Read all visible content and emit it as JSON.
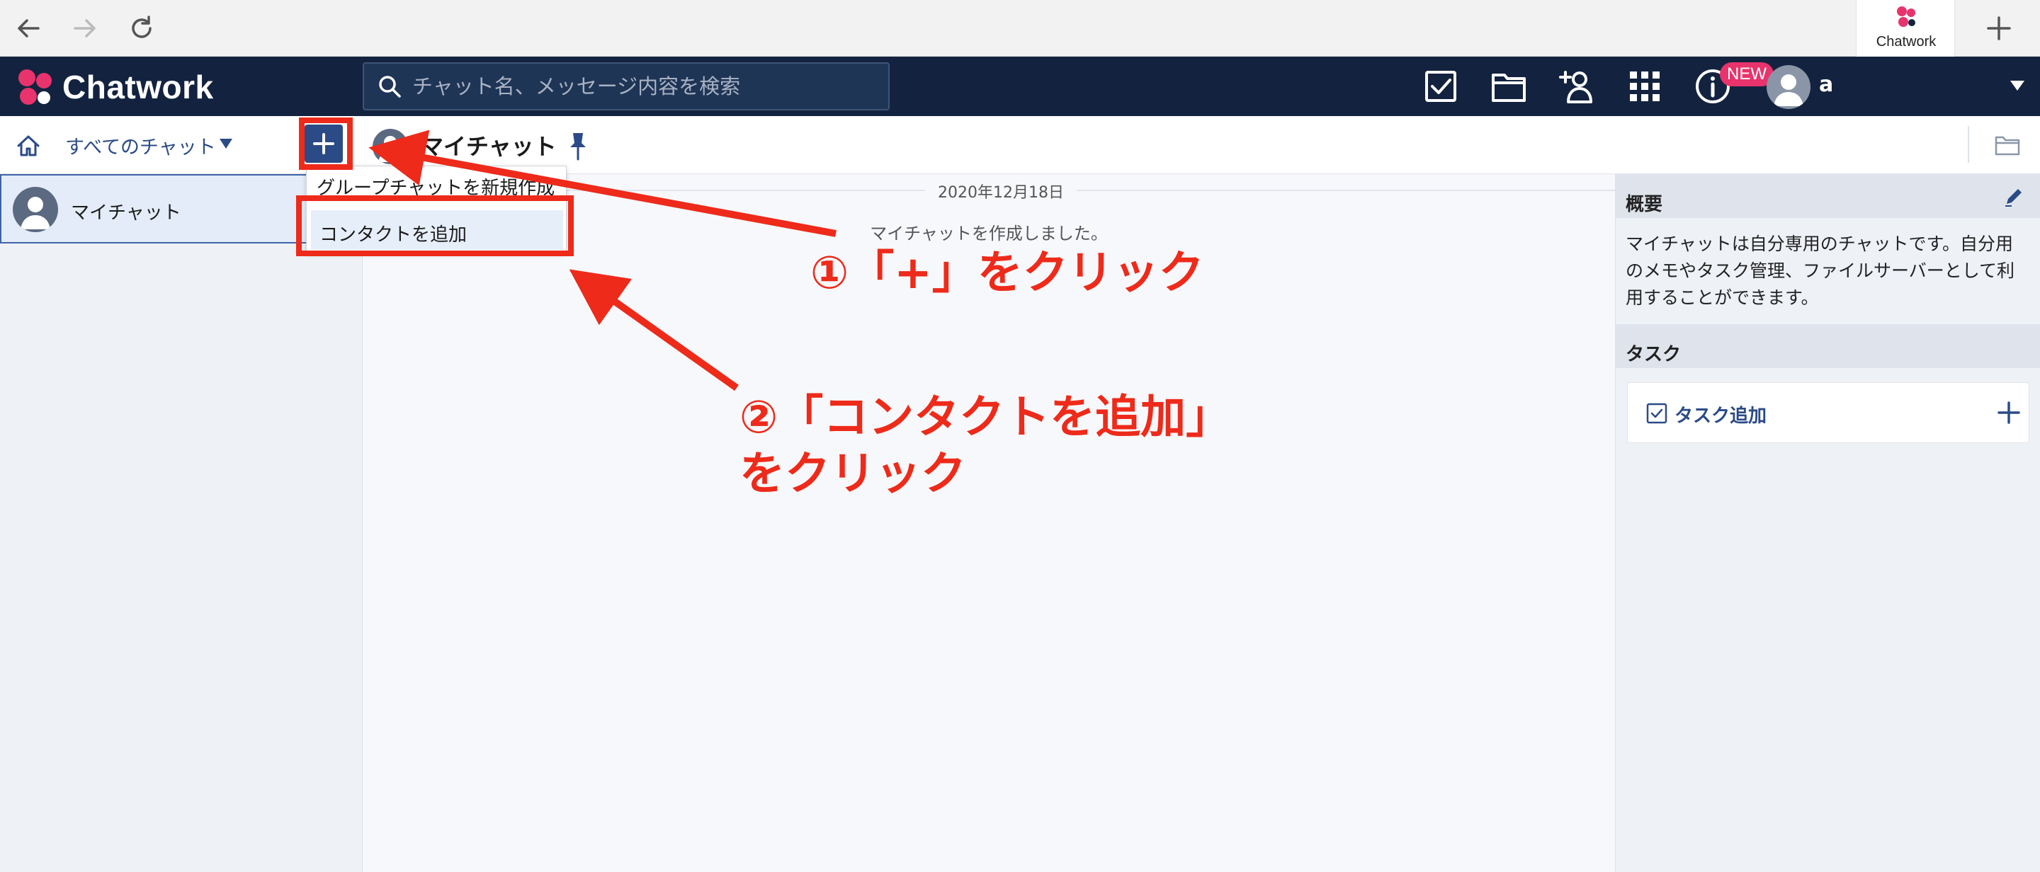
{
  "browser": {
    "tab_label": "Chatwork",
    "new_tab_icon": "plus-icon"
  },
  "header": {
    "logo_text": "Chatwork",
    "search_placeholder": "チャット名、メッセージ内容を検索",
    "new_badge": "NEW",
    "user_name": "a",
    "icons": [
      "task-icon",
      "file-icon",
      "add-contact-icon",
      "apps-grid-icon",
      "info-icon"
    ]
  },
  "subheader": {
    "filter_label": "すべてのチャット",
    "room_title": "マイチャット"
  },
  "sidebar": {
    "items": [
      {
        "label": "マイチャット"
      }
    ]
  },
  "dropdown": {
    "items": [
      "グループチャットを新規作成",
      "コンタクトを追加"
    ],
    "highlighted_index": 1
  },
  "chat": {
    "date_label": "2020年12月18日",
    "system_message": "マイチャットを作成しました。"
  },
  "right_panel": {
    "overview_title": "概要",
    "overview_text": "マイチャットは自分専用のチャットです。自分用のメモやタスク管理、ファイルサーバーとして利用することができます。",
    "task_title": "タスク",
    "task_add_label": "タスク追加"
  },
  "annotations": {
    "step1": "①「+」をクリック",
    "step2_line1": "②「コンタクトを追加」",
    "step2_line2": "をクリック",
    "color": "#ee2a1a"
  },
  "colors": {
    "header_bg": "#13233f",
    "accent": "#2b4b86",
    "badge": "#e8336d"
  }
}
